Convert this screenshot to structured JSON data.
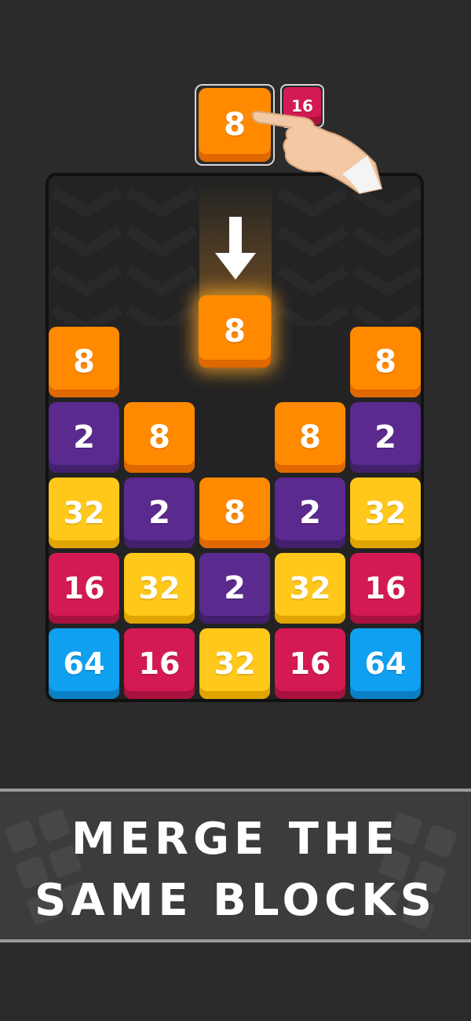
{
  "preview": {
    "current": {
      "value": "8",
      "color": "orange"
    },
    "next": {
      "value": "16",
      "color": "crimson"
    }
  },
  "falling_block": {
    "value": "8",
    "color": "orange"
  },
  "board": {
    "columns": 5,
    "cells": [
      [
        "8",
        "",
        "",
        "",
        "8"
      ],
      [
        "2",
        "8",
        "",
        "8",
        "2"
      ],
      [
        "32",
        "2",
        "8",
        "2",
        "32"
      ],
      [
        "16",
        "32",
        "2",
        "32",
        "16"
      ],
      [
        "64",
        "16",
        "32",
        "16",
        "64"
      ]
    ]
  },
  "tile_colors": {
    "2": {
      "face": "#5b2a8f",
      "edge": "#43206b"
    },
    "8": {
      "face": "#ff8a00",
      "edge": "#e06800"
    },
    "16": {
      "face": "#d41a52",
      "edge": "#a8123f"
    },
    "32": {
      "face": "#ffc81a",
      "edge": "#e0a400"
    },
    "64": {
      "face": "#10a0f0",
      "edge": "#0a7fc4"
    }
  },
  "banner": {
    "line1": "MERGE THE",
    "line2": "SAME BLOCKS"
  }
}
